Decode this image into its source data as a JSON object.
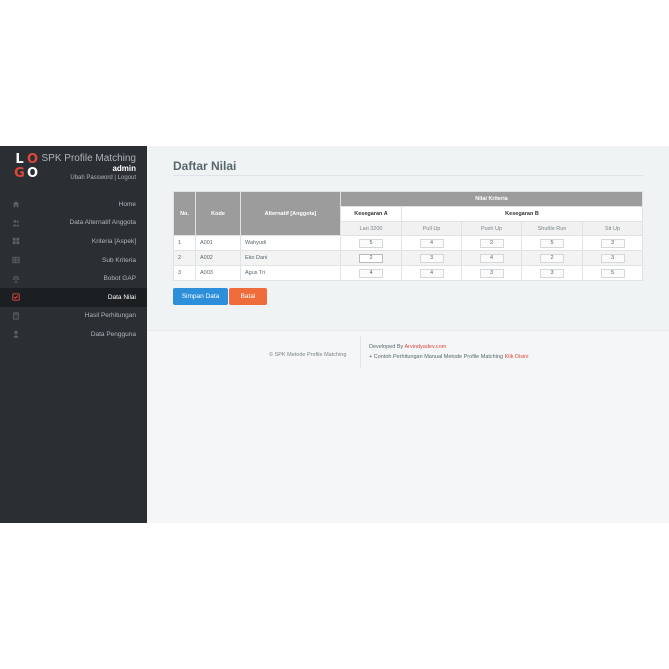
{
  "brand": {
    "logo_letters": [
      "L",
      "O",
      "G",
      "O"
    ],
    "app_name": "SPK Profile Matching",
    "user": "admin",
    "change_password": "Ubah Password",
    "separator": " | ",
    "logout": "Logout"
  },
  "menu": [
    {
      "label": "Home",
      "icon": "home-icon"
    },
    {
      "label": "Data Alternatif Anggota",
      "icon": "users-icon"
    },
    {
      "label": "Kriteria [Aspek]",
      "icon": "grid-icon"
    },
    {
      "label": "Sub Kriteria",
      "icon": "table-icon"
    },
    {
      "label": "Bobot GAP",
      "icon": "scale-icon"
    },
    {
      "label": "Data Nilai",
      "icon": "checkbox-icon",
      "active": true
    },
    {
      "label": "Hasil Perhitungan",
      "icon": "calculator-icon"
    },
    {
      "label": "Data Pengguna",
      "icon": "user-icon"
    }
  ],
  "page": {
    "title": "Daftar Nilai"
  },
  "table": {
    "headers": {
      "no": "No.",
      "kode": "Kode",
      "alternatif": "Alternatif [Anggota]",
      "nilai_kriteria": "Nilai Kriteria",
      "group_a": "Kesegaran A",
      "group_b": "Kesegaran B",
      "sub": [
        "Lari 3200",
        "Pull Up",
        "Push Up",
        "Shuttle Run",
        "Sit Up"
      ]
    },
    "rows": [
      {
        "no": "1",
        "kode": "A001",
        "nama": "Wahyudi",
        "values": [
          "5",
          "4",
          "2",
          "5",
          "3"
        ]
      },
      {
        "no": "2",
        "kode": "A002",
        "nama": "Eko Dani",
        "values": [
          "2",
          "3",
          "4",
          "2",
          "3"
        ]
      },
      {
        "no": "3",
        "kode": "A003",
        "nama": "Agus Tri",
        "values": [
          "4",
          "4",
          "3",
          "3",
          "5"
        ]
      }
    ]
  },
  "buttons": {
    "save": "Simpan Data",
    "cancel": "Batal"
  },
  "footer": {
    "copyright": "© SPK Metode Profile Matching",
    "developed_prefix": "Developed By ",
    "developer": "Arvindyadev.com",
    "contoh_prefix": "+ Contoh Perhitungan Manual Metode Profile Matching ",
    "contoh_link": "Klik Disini"
  },
  "colors": {
    "sidebar_bg": "#2b2f33",
    "save_button": "#2d8fd9",
    "cancel_button": "#ee6d3a",
    "logo_red": "#e0473c"
  }
}
